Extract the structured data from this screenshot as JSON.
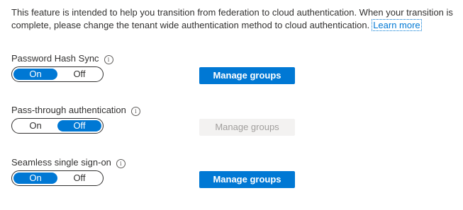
{
  "intro": {
    "text": "This feature is intended to help you transition from federation to cloud authentication. When your transition is complete, please change the tenant wide authentication method to cloud authentication.",
    "link": "Learn more"
  },
  "sections": [
    {
      "label": "Password Hash Sync",
      "info_icon": "i",
      "on_label": "On",
      "off_label": "Off",
      "selected": "On",
      "button_label": "Manage groups",
      "button_enabled": true
    },
    {
      "label": "Pass-through authentication",
      "info_icon": "i",
      "on_label": "On",
      "off_label": "Off",
      "selected": "Off",
      "button_label": "Manage groups",
      "button_enabled": false
    },
    {
      "label": "Seamless single sign-on",
      "info_icon": "i",
      "on_label": "On",
      "off_label": "Off",
      "selected": "On",
      "button_label": "Manage groups",
      "button_enabled": true
    }
  ],
  "colors": {
    "accent": "#0078d4",
    "disabled_bg": "#f3f2f1",
    "disabled_text": "#a19f9d"
  }
}
